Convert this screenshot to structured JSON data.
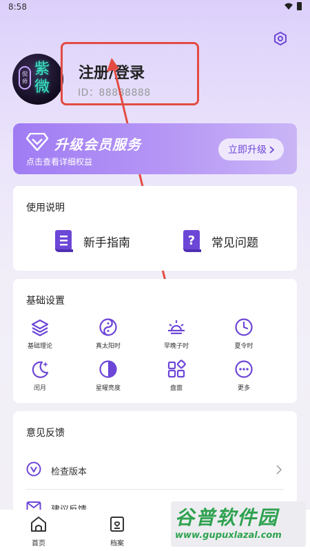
{
  "status_bar": {
    "time": "8:58"
  },
  "profile": {
    "login_title": "注册/登录",
    "user_id": "ID：88888888",
    "avatar_seal": "倪师",
    "avatar_text": "紫微"
  },
  "vip_banner": {
    "title": "升级会员服务",
    "subtitle": "点击查看详细权益",
    "button_label": "立即升级"
  },
  "instructions": {
    "title": "使用说明",
    "items": [
      {
        "label": "新手指南",
        "icon": "book-icon"
      },
      {
        "label": "常见问题",
        "icon": "question-book-icon"
      }
    ]
  },
  "basic_settings": {
    "title": "基础设置",
    "items": [
      {
        "label": "基础理论",
        "icon": "layers-icon"
      },
      {
        "label": "真太阳时",
        "icon": "yin-yang-icon"
      },
      {
        "label": "早晚子时",
        "icon": "sunrise-icon"
      },
      {
        "label": "夏令时",
        "icon": "clock-icon"
      },
      {
        "label": "闰月",
        "icon": "moon-icon"
      },
      {
        "label": "星曜亮度",
        "icon": "contrast-icon"
      },
      {
        "label": "盘面",
        "icon": "grid-icon"
      },
      {
        "label": "更多",
        "icon": "more-icon"
      }
    ]
  },
  "feedback": {
    "title": "意见反馈",
    "items": [
      {
        "label": "检查版本",
        "icon": "version-icon"
      },
      {
        "label": "建议反馈",
        "icon": "mail-icon"
      }
    ]
  },
  "bottom_nav": {
    "items": [
      {
        "label": "首页",
        "icon": "home-icon"
      },
      {
        "label": "档案",
        "icon": "archive-icon"
      }
    ]
  },
  "watermark": {
    "brand": "谷普软件园",
    "url": "www.gupuxlazal.com"
  },
  "colors": {
    "accent": "#6c46d6",
    "annotation": "#e34b41",
    "banner_start": "#a07cf4",
    "banner_end": "#cab5f6"
  }
}
